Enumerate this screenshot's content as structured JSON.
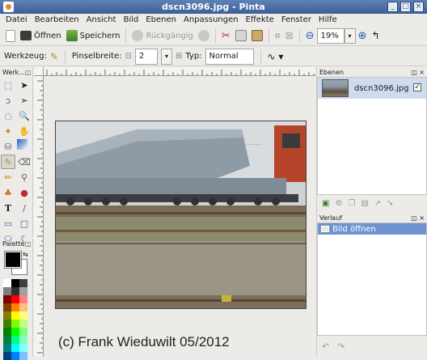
{
  "window": {
    "title": "dscn3096.jpg - Pinta",
    "controls": [
      "_",
      "□",
      "×"
    ]
  },
  "menu": [
    "Datei",
    "Bearbeiten",
    "Ansicht",
    "Bild",
    "Ebenen",
    "Anpassungen",
    "Effekte",
    "Fenster",
    "Hilfe"
  ],
  "toolbar": {
    "open_label": "Öffnen",
    "save_label": "Speichern",
    "undo_label": "Rückgängig",
    "zoom_value": "19%"
  },
  "tool_options": {
    "tool_label": "Werkzeug:",
    "brush_width_label": "Pinselbreite:",
    "brush_width_value": "2",
    "type_label": "Typ:",
    "type_value": "Normal"
  },
  "tools_panel": {
    "title": "Werk...",
    "palette_title": "Palette"
  },
  "canvas": {
    "caption": "(c) Frank Wieduwilt 05/2012"
  },
  "layers_panel": {
    "title": "Ebenen",
    "layer_name": "dscn3096.jpg",
    "layer_visible": true
  },
  "history_panel": {
    "title": "Verlauf",
    "items": [
      "Bild öffnen"
    ]
  },
  "colors": {
    "titlebar": "#4a6fa8",
    "selection": "#6f93cf",
    "primary": "#000000",
    "secondary": "#ffffff"
  }
}
